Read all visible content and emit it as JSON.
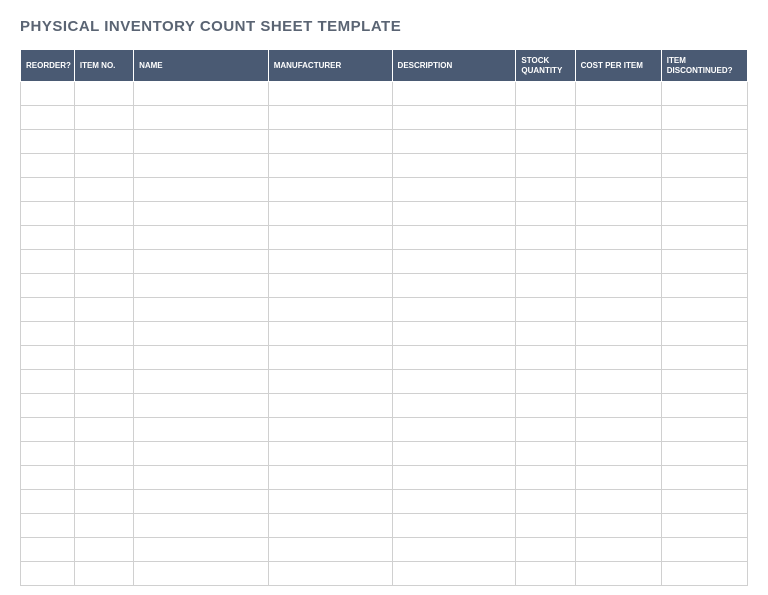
{
  "title": "PHYSICAL INVENTORY COUNT SHEET TEMPLATE",
  "columns": {
    "reorder": "REORDER?",
    "itemno": "ITEM NO.",
    "name": "NAME",
    "manufacturer": "MANUFACTURER",
    "description": "DESCRIPTION",
    "stock": "STOCK QUANTITY",
    "cost": "COST PER ITEM",
    "discontinued": "ITEM DISCONTINUED?"
  },
  "rows": [
    {
      "reorder": "",
      "itemno": "",
      "name": "",
      "manufacturer": "",
      "description": "",
      "stock": "",
      "cost": "",
      "discontinued": ""
    },
    {
      "reorder": "",
      "itemno": "",
      "name": "",
      "manufacturer": "",
      "description": "",
      "stock": "",
      "cost": "",
      "discontinued": ""
    },
    {
      "reorder": "",
      "itemno": "",
      "name": "",
      "manufacturer": "",
      "description": "",
      "stock": "",
      "cost": "",
      "discontinued": ""
    },
    {
      "reorder": "",
      "itemno": "",
      "name": "",
      "manufacturer": "",
      "description": "",
      "stock": "",
      "cost": "",
      "discontinued": ""
    },
    {
      "reorder": "",
      "itemno": "",
      "name": "",
      "manufacturer": "",
      "description": "",
      "stock": "",
      "cost": "",
      "discontinued": ""
    },
    {
      "reorder": "",
      "itemno": "",
      "name": "",
      "manufacturer": "",
      "description": "",
      "stock": "",
      "cost": "",
      "discontinued": ""
    },
    {
      "reorder": "",
      "itemno": "",
      "name": "",
      "manufacturer": "",
      "description": "",
      "stock": "",
      "cost": "",
      "discontinued": ""
    },
    {
      "reorder": "",
      "itemno": "",
      "name": "",
      "manufacturer": "",
      "description": "",
      "stock": "",
      "cost": "",
      "discontinued": ""
    },
    {
      "reorder": "",
      "itemno": "",
      "name": "",
      "manufacturer": "",
      "description": "",
      "stock": "",
      "cost": "",
      "discontinued": ""
    },
    {
      "reorder": "",
      "itemno": "",
      "name": "",
      "manufacturer": "",
      "description": "",
      "stock": "",
      "cost": "",
      "discontinued": ""
    },
    {
      "reorder": "",
      "itemno": "",
      "name": "",
      "manufacturer": "",
      "description": "",
      "stock": "",
      "cost": "",
      "discontinued": ""
    },
    {
      "reorder": "",
      "itemno": "",
      "name": "",
      "manufacturer": "",
      "description": "",
      "stock": "",
      "cost": "",
      "discontinued": ""
    },
    {
      "reorder": "",
      "itemno": "",
      "name": "",
      "manufacturer": "",
      "description": "",
      "stock": "",
      "cost": "",
      "discontinued": ""
    },
    {
      "reorder": "",
      "itemno": "",
      "name": "",
      "manufacturer": "",
      "description": "",
      "stock": "",
      "cost": "",
      "discontinued": ""
    },
    {
      "reorder": "",
      "itemno": "",
      "name": "",
      "manufacturer": "",
      "description": "",
      "stock": "",
      "cost": "",
      "discontinued": ""
    },
    {
      "reorder": "",
      "itemno": "",
      "name": "",
      "manufacturer": "",
      "description": "",
      "stock": "",
      "cost": "",
      "discontinued": ""
    },
    {
      "reorder": "",
      "itemno": "",
      "name": "",
      "manufacturer": "",
      "description": "",
      "stock": "",
      "cost": "",
      "discontinued": ""
    },
    {
      "reorder": "",
      "itemno": "",
      "name": "",
      "manufacturer": "",
      "description": "",
      "stock": "",
      "cost": "",
      "discontinued": ""
    },
    {
      "reorder": "",
      "itemno": "",
      "name": "",
      "manufacturer": "",
      "description": "",
      "stock": "",
      "cost": "",
      "discontinued": ""
    },
    {
      "reorder": "",
      "itemno": "",
      "name": "",
      "manufacturer": "",
      "description": "",
      "stock": "",
      "cost": "",
      "discontinued": ""
    },
    {
      "reorder": "",
      "itemno": "",
      "name": "",
      "manufacturer": "",
      "description": "",
      "stock": "",
      "cost": "",
      "discontinued": ""
    }
  ]
}
